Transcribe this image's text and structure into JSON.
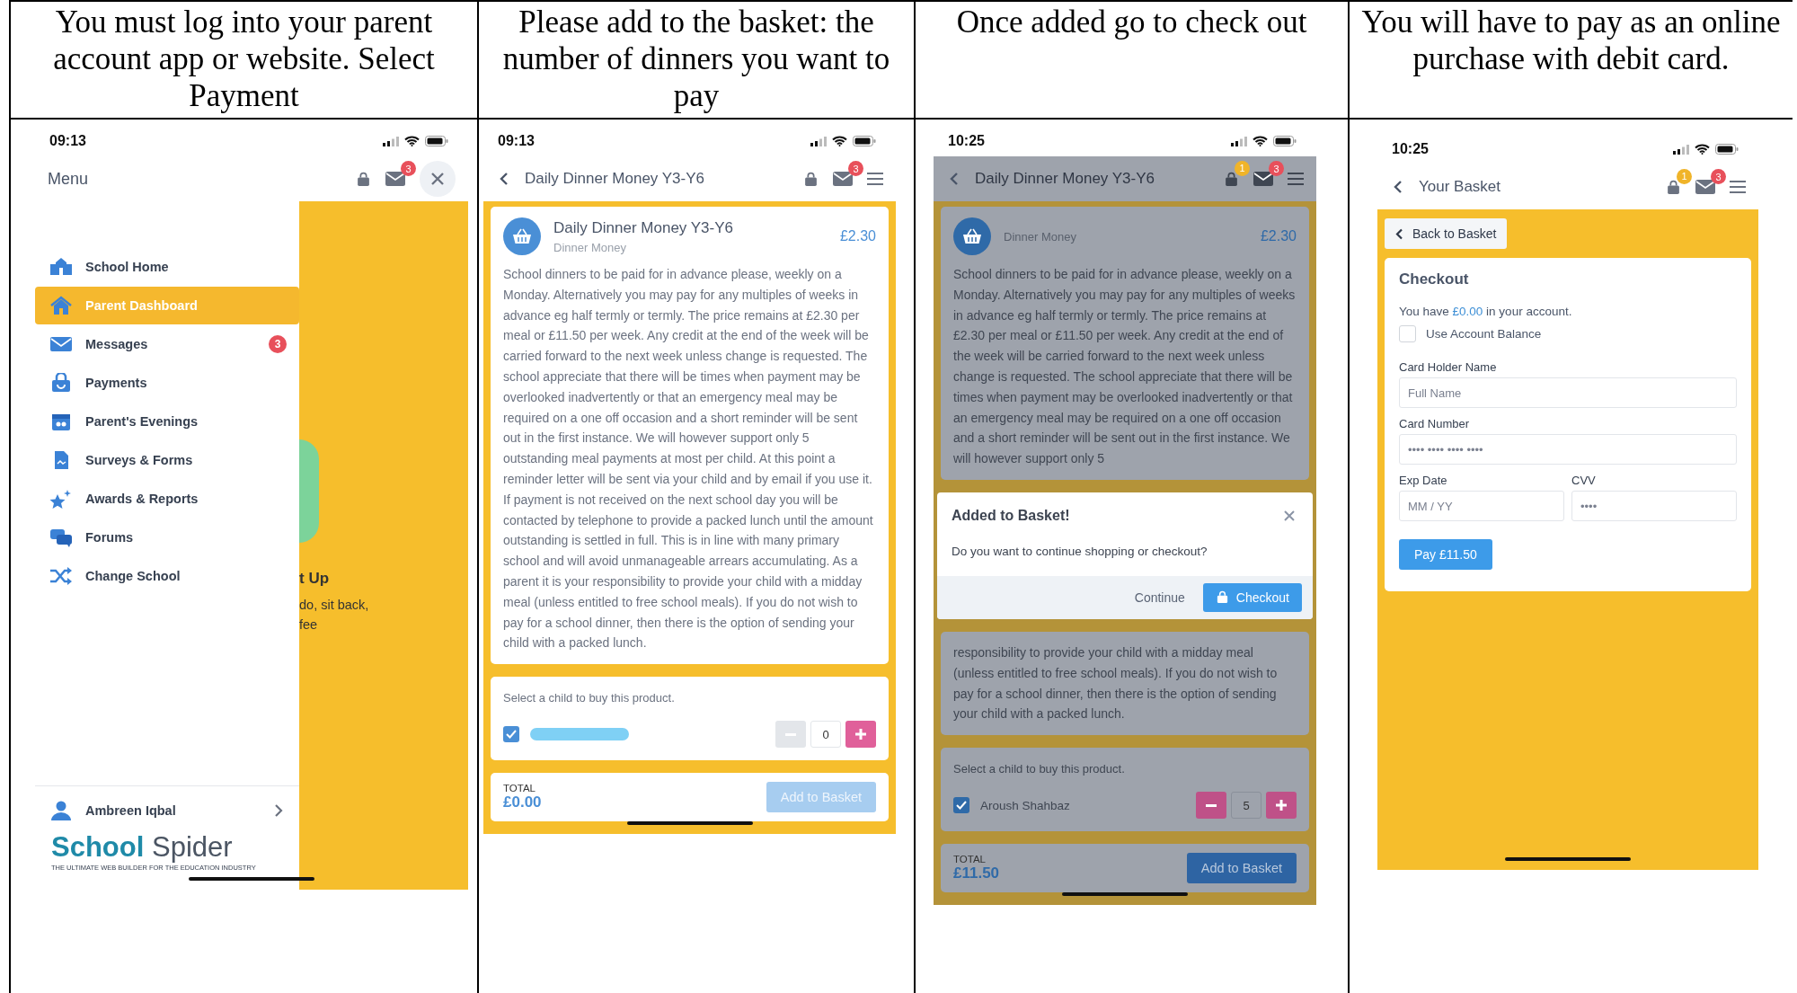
{
  "table": {
    "headers": [
      "You must log into your parent account app or website. Select Payment",
      "Please add to the basket: the number of dinners you want to pay",
      "Once added go to check out",
      "You will have to pay as an online purchase with debit card."
    ]
  },
  "screens": [
    {
      "kind": "menu",
      "time": "09:13",
      "title": "Menu",
      "mail_badge": "3",
      "items": [
        {
          "label": "School Home",
          "selected": false
        },
        {
          "label": "Parent Dashboard",
          "selected": true
        },
        {
          "label": "Messages",
          "selected": false,
          "badge": "3"
        },
        {
          "label": "Payments",
          "selected": false
        },
        {
          "label": "Parent's Evenings",
          "selected": false
        },
        {
          "label": "Surveys & Forms",
          "selected": false
        },
        {
          "label": "Awards & Reports",
          "selected": false
        },
        {
          "label": "Forums",
          "selected": false
        },
        {
          "label": "Change School",
          "selected": false
        }
      ],
      "behind": {
        "heading": "t Up",
        "lines": [
          "do, sit back,",
          "fee"
        ]
      },
      "user": "Ambreen Iqbal",
      "logo": {
        "first": "School",
        "second": "Spider",
        "tagline": "THE ULTIMATE WEB BUILDER FOR THE EDUCATION INDUSTRY"
      }
    },
    {
      "kind": "product",
      "dimmed": false,
      "time": "09:13",
      "title": "Daily Dinner Money Y3-Y6",
      "mail_badge": "3",
      "product": {
        "name": "Daily Dinner Money Y3-Y6",
        "category": "Dinner Money",
        "price": "£2.30",
        "description": [
          "School dinners to be paid for in advance please, weekly on a Monday. Alternatively you may pay for any multiples of weeks in advance eg half termly or termly. The price remains at £2.30 per meal or £11.50 per week. Any credit at the end of the week will be carried forward to the next week unless change is requested. The school appreciate that there will be times when payment may be overlooked inadvertently or that an emergency meal may be required on a one off occasion and a short reminder will be sent out in the first instance. We will however support only 5 outstanding meal payments at most per child. At this point a reminder letter will be sent via your child and by email if you use it. If payment is not received on the next school day you will be contacted by telephone to provide a packed lunch until the amount outstanding is settled in full. This is in line with many primary school and will avoid unmanageable arrears accumulating. As a parent it is your responsibility to provide your child with a midday meal (unless entitled to free school meals). If you do not wish to pay for a school dinner, then there is the option of sending your child with a packed lunch."
        ]
      },
      "child_prompt": "Select a child to buy this product.",
      "child": {
        "checked": true,
        "name_redacted": true
      },
      "quantity": "0",
      "minus_disabled": true,
      "total_label": "TOTAL",
      "total": "£0.00",
      "add_button": {
        "label": "Add to Basket",
        "disabled": true
      }
    },
    {
      "kind": "product",
      "dimmed": true,
      "time": "10:25",
      "title": "Daily Dinner Money Y3-Y6",
      "basket_badge": "1",
      "mail_badge": "3",
      "product": {
        "category": "Dinner Money",
        "price": "£2.30",
        "description": [
          "School dinners to be paid for in advance please, weekly on a Monday. Alternatively you may pay for any multiples of weeks in advance eg half termly or termly. The price remains at £2.30 per meal or £11.50 per week. Any credit at the end of the week will be carried forward to the next week unless change is requested. The school appreciate that there will be times when payment may be overlooked inadvertently or that an emergency meal may be required on a one off occasion and a short reminder will be sent out in the first instance. We will however support only 5",
          "responsibility to provide your child with a midday meal (unless entitled to free school meals). If you do not wish to pay for a school dinner, then there is the option of sending your child with a packed lunch."
        ]
      },
      "modal": {
        "title": "Added to Basket!",
        "message": "Do you want to continue shopping or checkout?",
        "continue": "Continue",
        "checkout": "Checkout"
      },
      "child_prompt": "Select a child to buy this product.",
      "child": {
        "checked": true,
        "name": "Aroush Shahbaz"
      },
      "quantity": "5",
      "minus_disabled": false,
      "total_label": "TOTAL",
      "total": "£11.50",
      "add_button": {
        "label": "Add to Basket",
        "disabled": false
      }
    },
    {
      "kind": "checkout",
      "time": "10:25",
      "title": "Your Basket",
      "basket_badge": "1",
      "mail_badge": "3",
      "back": "Back to Basket",
      "heading": "Checkout",
      "balance": {
        "before": "You have",
        "amount": "£0.00",
        "after": "in your account."
      },
      "use_balance": {
        "label": "Use Account Balance",
        "checked": false
      },
      "fields": [
        {
          "label": "Card Holder Name",
          "placeholder": "Full Name"
        },
        {
          "label": "Card Number",
          "placeholder": "•••• •••• •••• ••••"
        },
        {
          "label": "Exp Date",
          "placeholder": "MM / YY"
        },
        {
          "label": "CVV",
          "placeholder": "••••"
        }
      ],
      "pay_button": "Pay £11.50"
    }
  ]
}
